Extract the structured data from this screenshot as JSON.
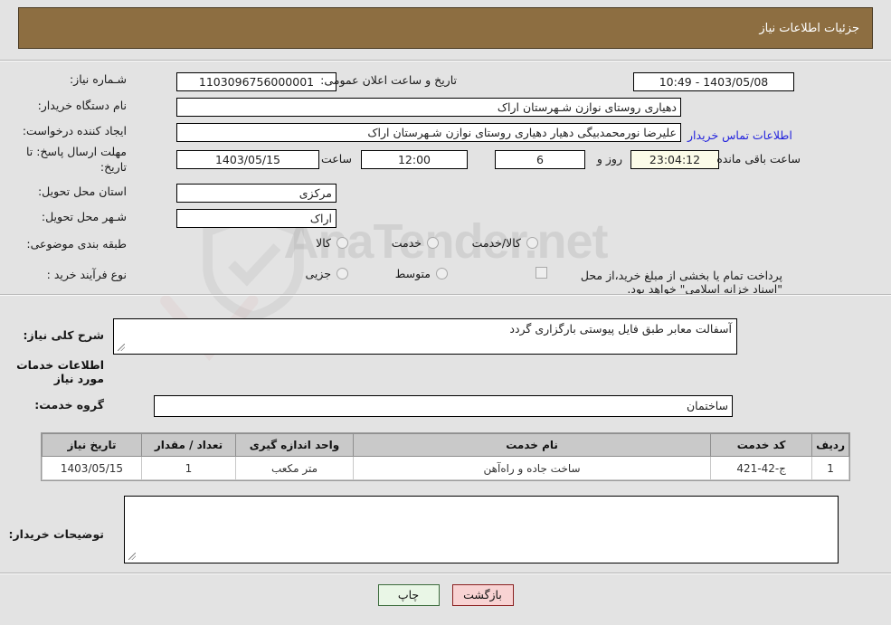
{
  "header": {
    "title": "جزئیات اطلاعات نیاز"
  },
  "watermark": {
    "text": "AnaTender.net",
    "shield_icon": "shield-icon",
    "arrow_icon": "arrow-icon"
  },
  "form": {
    "need_number_label": "شـماره نیاز:",
    "need_number_value": "1103096756000001",
    "public_announce_label": "تاریخ و ساعت اعلان عمومی:",
    "public_announce_value": "1403/05/08 - 10:49",
    "buyer_org_label": "نام دستگاه خریدار:",
    "buyer_org_value": "دهیاری روستای نوازن شـهرستان اراک",
    "request_creator_label": "ایجاد کننده درخواست:",
    "request_creator_value": "علیرضا نورمحمدبیگی دهیار دهیاری روستای نوازن شـهرستان اراک",
    "contact_link": "اطلاعات تماس خریدار",
    "deadline_label": "مهلت ارسال پاسخ: تا تاریخ:",
    "deadline_date": "1403/05/15",
    "deadline_hour_label": "ساعت",
    "deadline_hour_value": "12:00",
    "remaining_days": "6",
    "remaining_days_label": "روز و",
    "remaining_time": "23:04:12",
    "remaining_suffix": "ساعت باقی مانده",
    "province_label": "استان محل تحویل:",
    "province_value": "مرکزی",
    "city_label": "شـهر محل تحویل:",
    "city_value": "اراک",
    "category_label": "طبقه بندی موضوعی:",
    "category_options": [
      "کالا",
      "خدمت",
      "کالا/خدمت"
    ],
    "category_selected": "",
    "process_label": "نوع فرآیند خرید :",
    "process_options": [
      "جزیی",
      "متوسط"
    ],
    "process_selected": "",
    "treasury_note": "پرداخت تمام یا بخشی از مبلغ خرید،از محل \"اسناد خزانه اسلامی\" خواهد بود.",
    "treasury_checked": false
  },
  "description": {
    "label": "شرح کلی نیاز:",
    "value": "آسفالت معابر طبق فایل پیوستی بارگزاری گردد"
  },
  "services_section": {
    "heading": "اطلاعات خدمات مورد نیاز",
    "group_label": "گروه خدمت:",
    "group_value": "ساختمان"
  },
  "table": {
    "columns": [
      "ردیف",
      "کد خدمت",
      "نام خدمت",
      "واحد اندازه گیری",
      "تعداد / مقدار",
      "تاریخ نیاز"
    ],
    "rows": [
      {
        "row_no": "1",
        "service_code": "ج-42-421",
        "service_name": "ساخت جاده و راه‌آهن",
        "unit": "متر مکعب",
        "quantity": "1",
        "need_date": "1403/05/15"
      }
    ]
  },
  "buyer_notes": {
    "label": "توضیحات خریدار:",
    "value": ""
  },
  "buttons": {
    "print": "چاپ",
    "back": "بازگشت"
  },
  "colors": {
    "header_brown": "#8d6e41",
    "page_bg": "#e3e3e3",
    "link_blue": "#2222dd",
    "countdown_bg": "#fbfbe8",
    "table_header_bg": "#c9c9c9",
    "btn_print_bg": "#e9f6e6",
    "btn_back_bg": "#f8d3d3"
  }
}
